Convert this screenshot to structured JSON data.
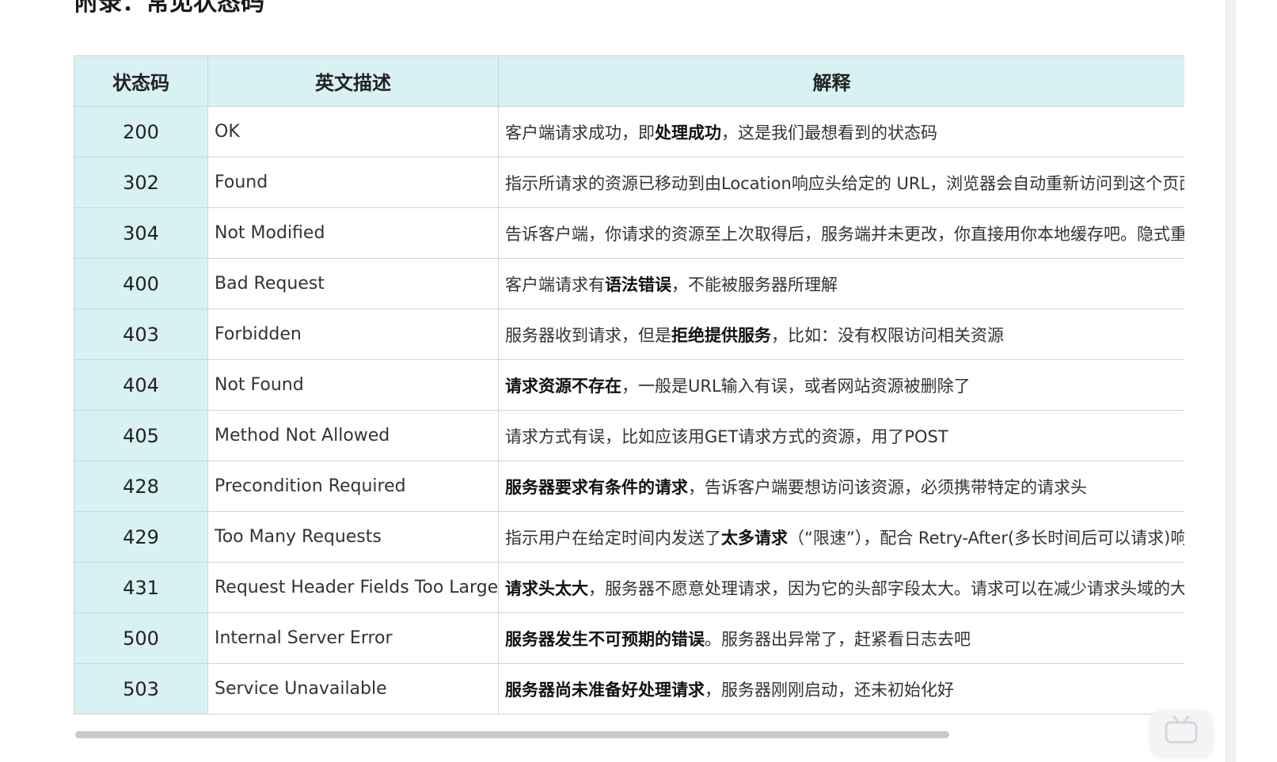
{
  "page": {
    "title": "附录：常见状态码"
  },
  "table": {
    "headers": {
      "code": "状态码",
      "description": "英文描述",
      "explanation": "解释"
    },
    "rows": [
      {
        "code": "200",
        "description": "OK",
        "explanation": [
          {
            "text": "客户端请求成功，即",
            "bold": false
          },
          {
            "text": "处理成功",
            "bold": true
          },
          {
            "text": "，这是我们最想看到的状态码",
            "bold": false
          }
        ]
      },
      {
        "code": "302",
        "description": "Found",
        "explanation": [
          {
            "text": "指示所请求的资源已移动到由Location响应头给定的 URL，浏览器会自动重新访问到这个页面",
            "bold": false
          }
        ]
      },
      {
        "code": "304",
        "description": "Not Modified",
        "explanation": [
          {
            "text": "告诉客户端，你请求的资源至上次取得后，服务端并未更改，你直接用你本地缓存吧。隐式重定向",
            "bold": false
          }
        ]
      },
      {
        "code": "400",
        "description": "Bad Request",
        "explanation": [
          {
            "text": "客户端请求有",
            "bold": false
          },
          {
            "text": "语法错误",
            "bold": true
          },
          {
            "text": "，不能被服务器所理解",
            "bold": false
          }
        ]
      },
      {
        "code": "403",
        "description": "Forbidden",
        "explanation": [
          {
            "text": "服务器收到请求，但是",
            "bold": false
          },
          {
            "text": "拒绝提供服务",
            "bold": true
          },
          {
            "text": "，比如：没有权限访问相关资源",
            "bold": false
          }
        ]
      },
      {
        "code": "404",
        "description": "Not Found",
        "explanation": [
          {
            "text": "请求资源不存在",
            "bold": true
          },
          {
            "text": "，一般是URL输入有误，或者网站资源被删除了",
            "bold": false
          }
        ]
      },
      {
        "code": "405",
        "description": "Method Not Allowed",
        "explanation": [
          {
            "text": "请求方式有误，比如应该用GET请求方式的资源，用了POST",
            "bold": false
          }
        ]
      },
      {
        "code": "428",
        "description": "Precondition Required",
        "explanation": [
          {
            "text": "服务器要求有条件的请求",
            "bold": true
          },
          {
            "text": "，告诉客户端要想访问该资源，必须携带特定的请求头",
            "bold": false
          }
        ]
      },
      {
        "code": "429",
        "description": "Too Many Requests",
        "explanation": [
          {
            "text": "指示用户在给定时间内发送了",
            "bold": false
          },
          {
            "text": "太多请求",
            "bold": true
          },
          {
            "text": "（“限速”），配合 Retry-After(多长时间后可以请求)响应头一起使用",
            "bold": false
          }
        ]
      },
      {
        "code": "431",
        "description": "Request Header Fields Too Large",
        "explanation": [
          {
            "text": "请求头太大",
            "bold": true
          },
          {
            "text": "，服务器不愿意处理请求，因为它的头部字段太大。请求可以在减少请求头域的大小后重新提交。",
            "bold": false
          }
        ]
      },
      {
        "code": "500",
        "description": "Internal Server Error",
        "explanation": [
          {
            "text": "服务器发生不可预期的错误",
            "bold": true
          },
          {
            "text": "。服务器出异常了，赶紧看日志去吧",
            "bold": false
          }
        ]
      },
      {
        "code": "503",
        "description": "Service Unavailable",
        "explanation": [
          {
            "text": "服务器尚未准备好处理请求",
            "bold": true
          },
          {
            "text": "，服务器刚刚启动，还未初始化好",
            "bold": false
          }
        ]
      }
    ]
  },
  "colors": {
    "header_bg": "#d8f1f2",
    "code_col_bg": "#d8f1f2",
    "border": "#d3d3d3"
  }
}
